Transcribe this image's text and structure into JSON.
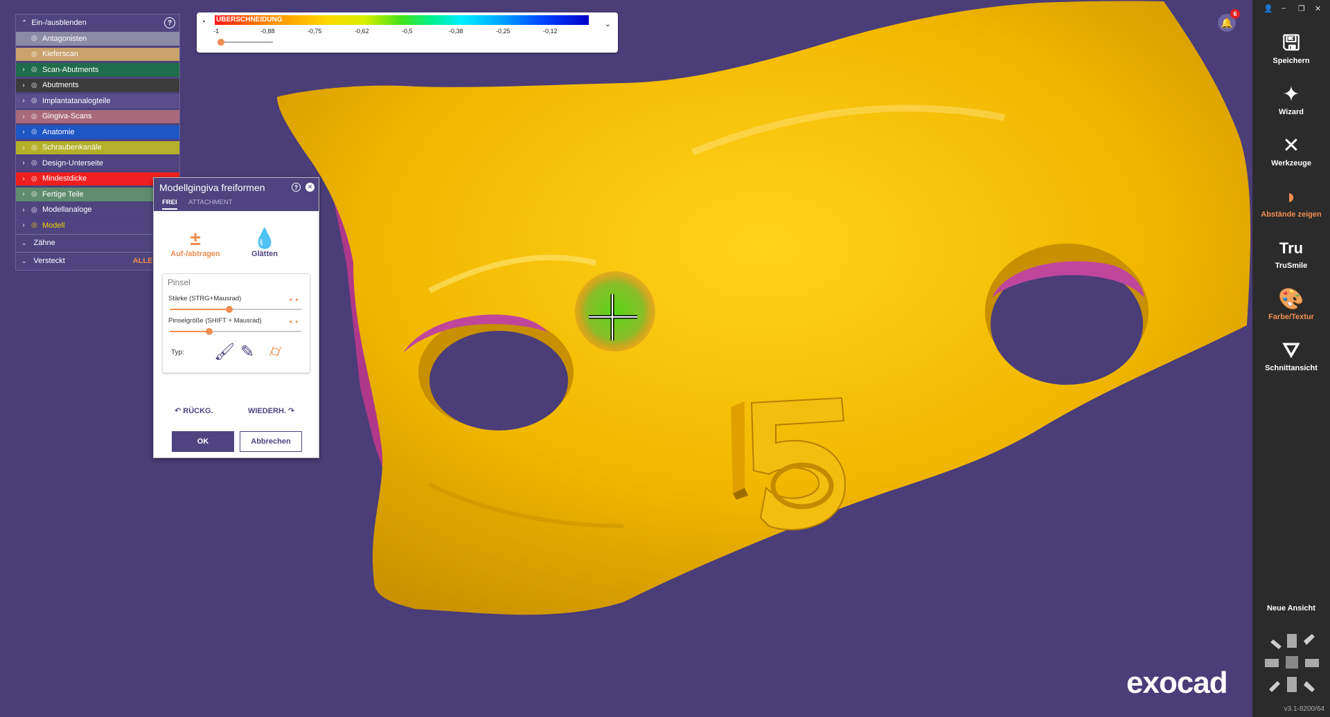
{
  "visibility_panel": {
    "title": "Ein-/ausblenden",
    "help_icon": "?",
    "items": [
      {
        "label": "Antagonisten",
        "color": "#8d8aa6",
        "expandable": false
      },
      {
        "label": "Kieferscan",
        "color": "#c9a26c",
        "expandable": false
      },
      {
        "label": "Scan-Abutments",
        "color": "#1f6d48",
        "expandable": true
      },
      {
        "label": "Abutments",
        "color": "#3b3b3b",
        "expandable": true
      },
      {
        "label": "Implantatanalogteile",
        "color": "#5a4f8c",
        "expandable": true
      },
      {
        "label": "Gingiva-Scans",
        "color": "#a86a7c",
        "expandable": true
      },
      {
        "label": "Anatomie",
        "color": "#1e56c4",
        "expandable": true
      },
      {
        "label": "Schraubenkanäle",
        "color": "#b4b02a",
        "expandable": true
      },
      {
        "label": "Design-Unterseite",
        "color": "#4f4480",
        "expandable": true
      },
      {
        "label": "Mindestdicke",
        "color": "#f01f1f",
        "expandable": true
      },
      {
        "label": "Fertige Teile",
        "color": "#5f8c6c",
        "expandable": true
      },
      {
        "label": "Modellanaloge",
        "color": "#4f4480",
        "expandable": true
      },
      {
        "label": "Modell",
        "color": "#4f4480",
        "expandable": true,
        "text_color": "#f2d000"
      }
    ],
    "section_zaehne": "Zähne",
    "section_versteckt": "Versteckt",
    "alle_anzeigen": "ALLE ANZE"
  },
  "scale": {
    "label": "ÜBERSCHNEIDUNG",
    "ticks": [
      "-1",
      "-0,88",
      "-0,75",
      "-0,62",
      "-0,5",
      "-0,38",
      "-0,25",
      "-0,12"
    ],
    "slider_value": 0
  },
  "dialog": {
    "title": "Modellgingiva freiformen",
    "tabs": [
      "FREI",
      "ATTACHMENT"
    ],
    "tool_add": "Auf-/abtragen",
    "tool_smooth": "Glätten",
    "brush_title": "Pinsel",
    "strength_label": "Stärke (STRG+Mausrad)",
    "strength_value": 0.45,
    "size_label": "Pinselgröße (SHIFT + Mausrad)",
    "size_value": 0.3,
    "type_label": "Typ:",
    "undo": "RÜCKG.",
    "redo": "WIEDERH.",
    "ok": "OK",
    "cancel": "Abbrechen"
  },
  "sidebar": {
    "items": [
      {
        "label": "Speichern",
        "icon": "save-icon",
        "glyph": "🖫",
        "highlight": false
      },
      {
        "label": "Wizard",
        "icon": "wand-icon",
        "glyph": "✦",
        "highlight": false
      },
      {
        "label": "Werkzeuge",
        "icon": "tools-icon",
        "glyph": "✕",
        "highlight": false
      },
      {
        "label": "Abstände zeigen",
        "icon": "distance-icon",
        "glyph": "◗",
        "highlight": true
      },
      {
        "label": "TruSmile",
        "icon": "trusmile-icon",
        "glyph": "Tru",
        "highlight": false
      },
      {
        "label": "Farbe/Textur",
        "icon": "palette-icon",
        "glyph": "🎨",
        "highlight": true
      },
      {
        "label": "Schnittansicht",
        "icon": "section-icon",
        "glyph": "⛛",
        "highlight": false
      }
    ],
    "neue_ansicht": "Neue Ansicht",
    "version": "v3.1-8200/64"
  },
  "notifications": {
    "count": "6"
  },
  "viewport": {
    "model_color": "#f2b800",
    "engraved_number": "15",
    "logo": "exocad"
  }
}
